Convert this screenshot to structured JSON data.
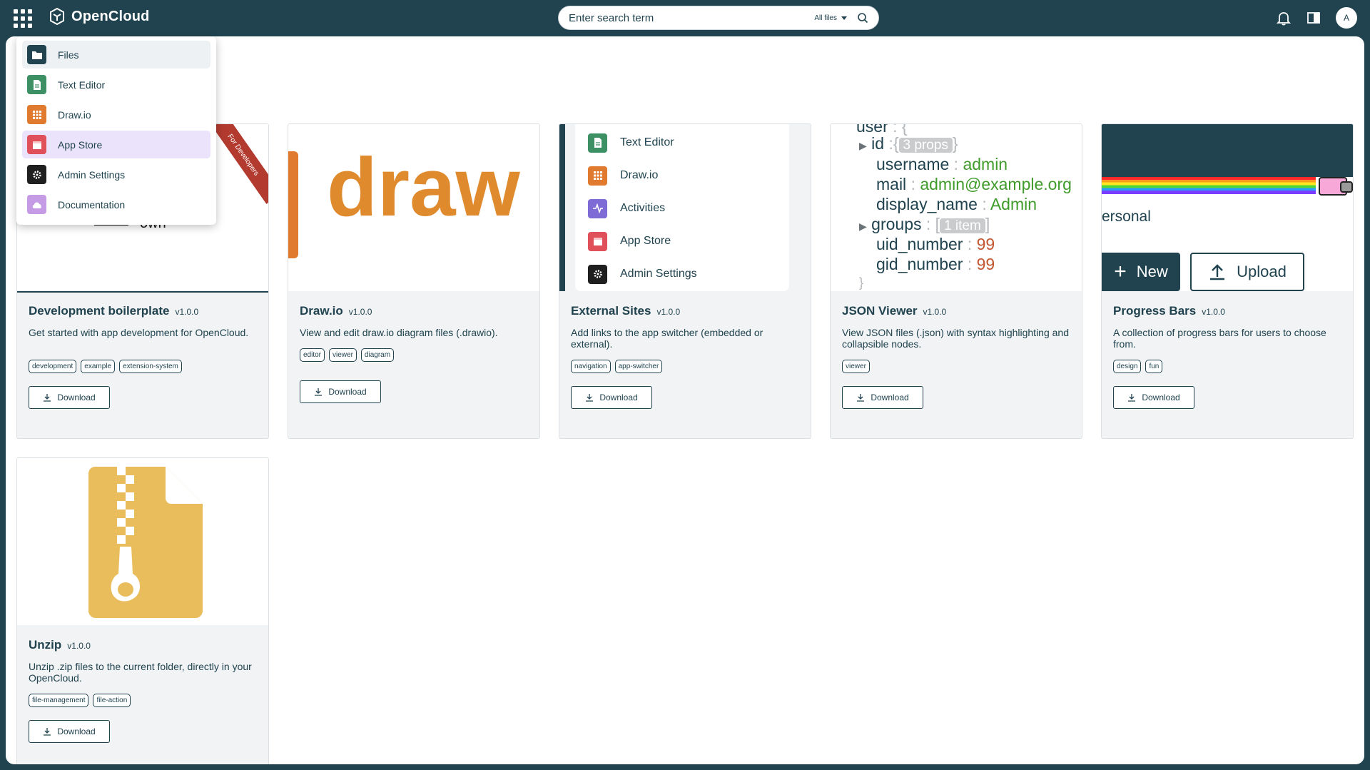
{
  "header": {
    "brand": "OpenCloud",
    "search": {
      "placeholder": "Enter search term",
      "scope": "All files"
    },
    "avatar_initial": "A"
  },
  "app_switcher": {
    "items": [
      {
        "label": "Files",
        "icon": "folder-icon",
        "color": "#20434f"
      },
      {
        "label": "Text Editor",
        "icon": "document-icon",
        "color": "#3d8f64"
      },
      {
        "label": "Draw.io",
        "icon": "grid-icon",
        "color": "#e07a2e"
      },
      {
        "label": "App Store",
        "icon": "store-icon",
        "color": "#e0505a"
      },
      {
        "label": "Admin Settings",
        "icon": "gear-icon",
        "color": "#1f1f1f"
      },
      {
        "label": "Documentation",
        "icon": "cloud-icon",
        "color": "#c59be6"
      }
    ]
  },
  "download_label": "Download",
  "apps": [
    {
      "title": "Development boilerplate",
      "version": "v1.0.0",
      "description": "Get started with app development for OpenCloud.",
      "tags": [
        "development",
        "example",
        "extension-system"
      ],
      "preview": {
        "ribbon": "For Developers",
        "text": "own"
      }
    },
    {
      "title": "Draw.io",
      "version": "v1.0.0",
      "description": "View and edit draw.io diagram files (.drawio).",
      "tags": [
        "editor",
        "viewer",
        "diagram"
      ],
      "preview": {
        "text": "draw"
      }
    },
    {
      "title": "External Sites",
      "version": "v1.0.0",
      "description": "Add links to the app switcher (embedded or external).",
      "tags": [
        "navigation",
        "app-switcher"
      ],
      "preview": {
        "items": [
          "Text Editor",
          "Draw.io",
          "Activities",
          "App Store",
          "Admin Settings"
        ]
      }
    },
    {
      "title": "JSON Viewer",
      "version": "v1.0.0",
      "description": "View JSON files (.json) with syntax highlighting and collapsible nodes.",
      "tags": [
        "viewer"
      ],
      "preview": {
        "root": "user",
        "id": "id",
        "id_pill": "3 props",
        "username_key": "username",
        "username": "admin",
        "mail_key": "mail",
        "mail": "admin@example.org",
        "display_key": "display_name",
        "display": "Admin",
        "groups_key": "groups",
        "groups_pill": "1 item",
        "uid_key": "uid_number",
        "uid": "99",
        "gid_key": "gid_number",
        "gid": "99"
      }
    },
    {
      "title": "Progress Bars",
      "version": "v1.0.0",
      "description": "A collection of progress bars for users to choose from.",
      "tags": [
        "design",
        "fun"
      ],
      "preview": {
        "text": "ersonal",
        "new": "New",
        "upload": "Upload"
      }
    },
    {
      "title": "Unzip",
      "version": "v1.0.0",
      "description": "Unzip .zip files to the current folder, directly in your OpenCloud.",
      "tags": [
        "file-management",
        "file-action"
      ]
    }
  ]
}
